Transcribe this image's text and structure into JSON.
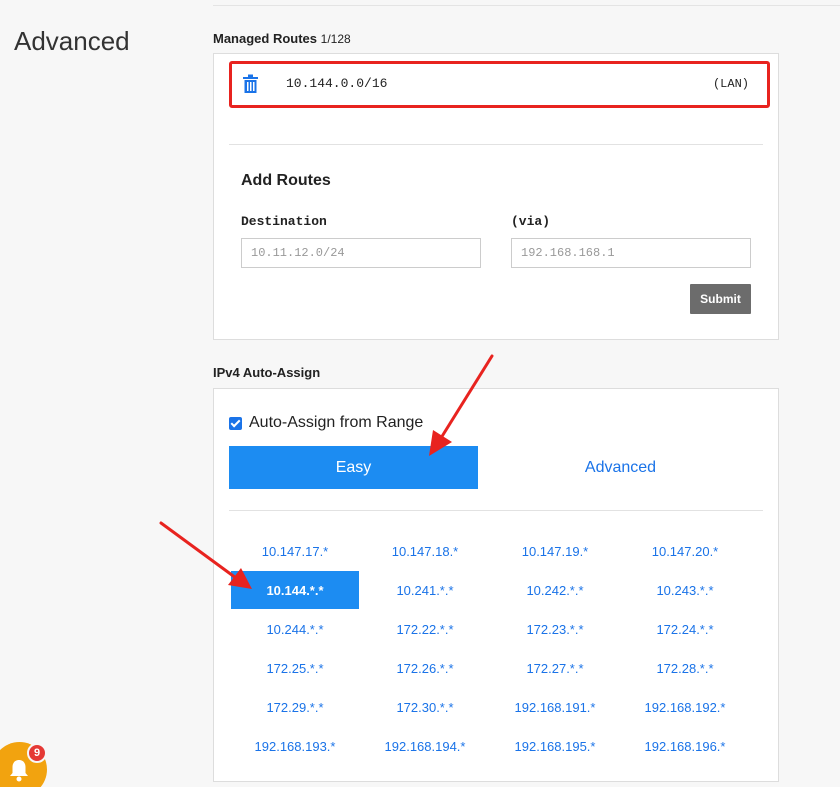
{
  "section_title": "Advanced",
  "managed_routes": {
    "heading": "Managed Routes",
    "count": "1/128",
    "routes": [
      {
        "cidr": "10.144.0.0/16",
        "tag": "(LAN)"
      }
    ]
  },
  "add_routes": {
    "title": "Add Routes",
    "destination_label": "Destination",
    "destination_placeholder": "10.11.12.0/24",
    "via_label": "(via)",
    "via_placeholder": "192.168.168.1",
    "submit_label": "Submit"
  },
  "ipv4": {
    "heading": "IPv4 Auto-Assign",
    "auto_assign_label": "Auto-Assign from Range",
    "auto_assign_checked": true,
    "tabs": [
      "Easy",
      "Advanced"
    ],
    "active_tab": "Easy",
    "ranges": [
      "10.147.17.*",
      "10.147.18.*",
      "10.147.19.*",
      "10.147.20.*",
      "10.144.*.*",
      "10.241.*.*",
      "10.242.*.*",
      "10.243.*.*",
      "10.244.*.*",
      "172.22.*.*",
      "172.23.*.*",
      "172.24.*.*",
      "172.25.*.*",
      "172.26.*.*",
      "172.27.*.*",
      "172.28.*.*",
      "172.29.*.*",
      "172.30.*.*",
      "192.168.191.*",
      "192.168.192.*",
      "192.168.193.*",
      "192.168.194.*",
      "192.168.195.*",
      "192.168.196.*"
    ],
    "selected_range": "10.144.*.*"
  },
  "notifications": {
    "count": "9",
    "icon": "bell-icon"
  },
  "colors": {
    "accent": "#1c8cf2",
    "highlight_border": "#e8231f",
    "annotation_arrow": "#e8231f",
    "bell": "#f2a30f",
    "badge": "#e53935"
  }
}
